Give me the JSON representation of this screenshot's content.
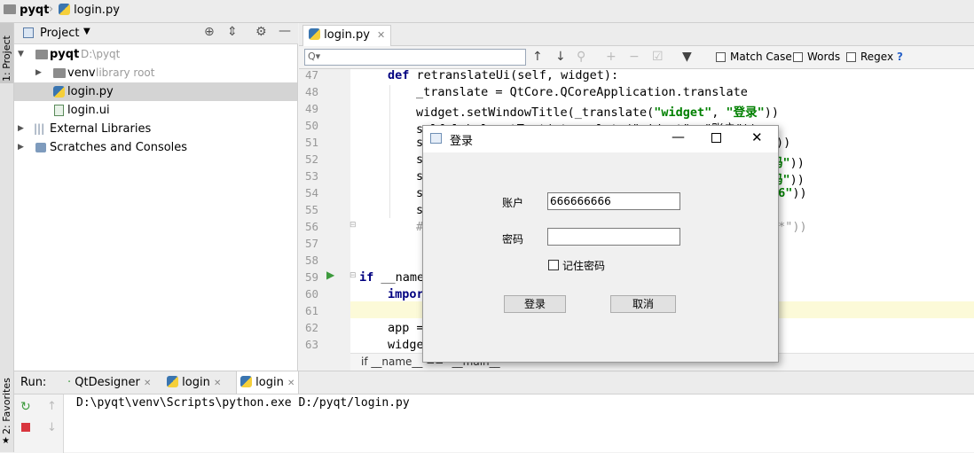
{
  "navbar": {
    "project": "pyqt",
    "file": "login.py"
  },
  "leftstrip": {
    "project_tool": "1: Project",
    "favorites_tool": "2: Favorites"
  },
  "project_panel": {
    "title": "Project",
    "tree": [
      {
        "label": "pyqt",
        "hint": "D:\\pyqt"
      },
      {
        "label": "venv",
        "hint": "library root"
      },
      {
        "label": "login.py",
        "hint": ""
      },
      {
        "label": "login.ui",
        "hint": ""
      },
      {
        "label": "External Libraries",
        "hint": ""
      },
      {
        "label": "Scratches and Consoles",
        "hint": ""
      }
    ]
  },
  "editor": {
    "tab": "login.py",
    "search": {
      "placeholder": "Q▾",
      "match_case": "Match Case",
      "words": "Words",
      "regex": "Regex",
      "help": "?"
    },
    "line_numbers": [
      "47",
      "48",
      "49",
      "50",
      "51",
      "52",
      "53",
      "54",
      "55",
      "56",
      "57",
      "58",
      "59",
      "60",
      "61",
      "62",
      "63"
    ],
    "breadcrumb": "if __name__ == \"__main__\"",
    "code": {
      "l47_kw": "def",
      "l47_rest": " retranslateUi(self, widget):",
      "l48": "_translate = QtCore.QCoreApplication.translate",
      "l49_a": "widget.setWindowTitle(_translate(",
      "l49_s1": "\"widget\"",
      "l49_b": ", ",
      "l49_s2": "\"登录\"",
      "l49_c": "))",
      "l50": "self.label.setText(_translate(\"widget\", \"账户\"))",
      "l51_tail": "))",
      "l52_tail_s": "码\"",
      "l52_tail": "))",
      "l53_tail_s": "码\"",
      "l53_tail": "))",
      "l54_tail_s": "66\"",
      "l54_tail": "))",
      "l56_tail": "**\"))",
      "l59_kw": "if",
      "l59_rest": " __name",
      "l60_kw": "impor",
      "l62": "app =",
      "l63": "widge",
      "frag_s": "s",
      "frag_hash": "#"
    }
  },
  "run_panel": {
    "label": "Run:",
    "tabs": [
      "QtDesigner",
      "login",
      "login"
    ],
    "console": "D:\\pyqt\\venv\\Scripts\\python.exe D:/pyqt/login.py"
  },
  "dialog": {
    "title": "登录",
    "account_label": "账户",
    "account_value": "666666666",
    "password_label": "密码",
    "password_value": "",
    "remember_label": "记住密码",
    "login_button": "登录",
    "cancel_button": "取消"
  }
}
